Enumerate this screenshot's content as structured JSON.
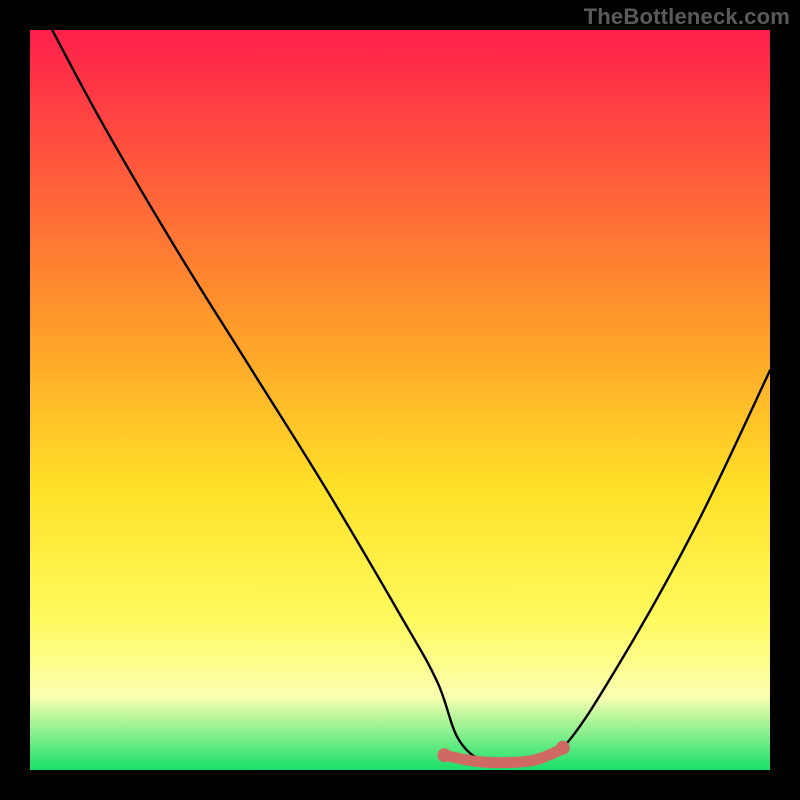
{
  "watermark": "TheBottleneck.com",
  "chart_data": {
    "type": "line",
    "title": "",
    "xlabel": "",
    "ylabel": "",
    "xlim": [
      0,
      100
    ],
    "ylim": [
      0,
      100
    ],
    "grid": false,
    "legend": false,
    "background_gradient": {
      "stops": [
        {
          "offset": 0,
          "color": "#ff1f4b"
        },
        {
          "offset": 40,
          "color": "#ff9b2a"
        },
        {
          "offset": 62,
          "color": "#ffe127"
        },
        {
          "offset": 80,
          "color": "#fffb60"
        },
        {
          "offset": 90,
          "color": "#fbffb0"
        },
        {
          "offset": 100,
          "color": "#17e06a"
        }
      ]
    },
    "series": [
      {
        "name": "bottleneck-curve",
        "color": "#000000",
        "x": [
          3,
          10,
          20,
          30,
          40,
          50,
          55,
          58,
          62,
          67,
          72,
          80,
          90,
          100
        ],
        "y": [
          100,
          87,
          70,
          54,
          38,
          21,
          12,
          4,
          1,
          1,
          3,
          15,
          33,
          54
        ]
      }
    ],
    "highlight_segment": {
      "color": "#cf6a62",
      "x": [
        56,
        60,
        64,
        68,
        71,
        72
      ],
      "y": [
        2.0,
        1.2,
        1.0,
        1.3,
        2.4,
        3.0
      ],
      "endpoint_markers": true
    }
  }
}
